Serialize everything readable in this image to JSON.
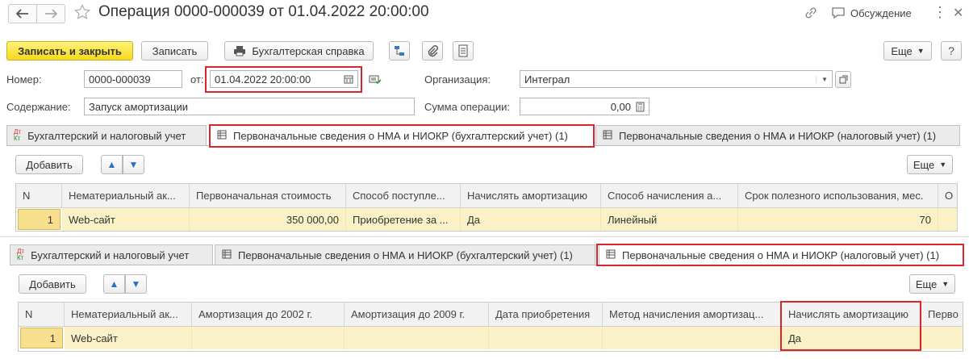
{
  "window": {
    "title": "Операция 0000-000039 от 01.04.2022 20:00:00",
    "discussion_label": "Обсуждение",
    "more_menu_glyph": "⋮",
    "close_glyph": "✕"
  },
  "toolbar": {
    "save_close_label": "Записать и закрыть",
    "save_label": "Записать",
    "accounting_note_label": "Бухгалтерская справка",
    "more_label": "Еще",
    "icons": [
      "structure-icon",
      "attachment-icon",
      "report-icon"
    ]
  },
  "form": {
    "number_label": "Номер:",
    "number_value": "0000-000039",
    "date_label": "от:",
    "date_value": "01.04.2022 20:00:00",
    "organization_label": "Организация:",
    "organization_value": "Интеграл",
    "content_label": "Содержание:",
    "content_value": "Запуск амортизации",
    "amount_label": "Сумма операции:",
    "amount_value": "0,00"
  },
  "tabs": [
    {
      "label": "Бухгалтерский и налоговый учет",
      "icon": "dt-kt-icon"
    },
    {
      "label": "Первоначальные сведения о НМА и НИОКР (бухгалтерский учет) (1)",
      "icon": "table-icon"
    },
    {
      "label": "Первоначальные сведения о НМА и НИОКР (налоговый учет) (1)",
      "icon": "table-icon"
    }
  ],
  "accounting_grid": {
    "add_label": "Добавить",
    "more_label": "Еще",
    "columns": [
      "N",
      "Нематериальный ак...",
      "Первоначальная стоимость",
      "Способ поступле...",
      "Начислять амортизацию",
      "Способ начисления а...",
      "Срок полезного использования, мес.",
      "О"
    ],
    "row": [
      "1",
      "Web-сайт",
      "350 000,00",
      "Приобретение за ...",
      "Да",
      "Линейный",
      "70",
      ""
    ]
  },
  "tax_grid": {
    "add_label": "Добавить",
    "more_label": "Еще",
    "columns": [
      "N",
      "Нематериальный ак...",
      "Амортизация до 2002 г.",
      "Амортизация до 2009 г.",
      "Дата приобретения",
      "Метод начисления амортизац...",
      "Начислять амортизацию",
      "Перво"
    ],
    "row": [
      "1",
      "Web-сайт",
      "",
      "",
      "",
      "",
      "Да",
      ""
    ]
  },
  "colors": {
    "highlight_red": "#d9262c",
    "primary_button": "#f5d91d",
    "selected_row": "#fbf1c7"
  }
}
